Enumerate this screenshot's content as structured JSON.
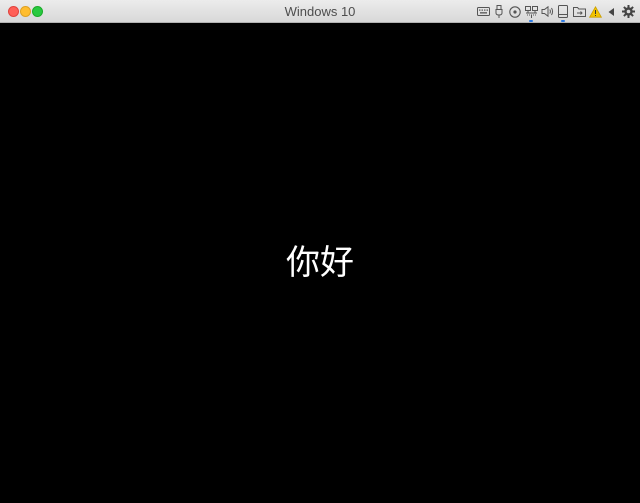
{
  "window": {
    "title": "Windows 10"
  },
  "vm_screen": {
    "greeting": "你好",
    "background_color": "#000000"
  },
  "status_icons": [
    {
      "name": "keyboard-icon",
      "active": false
    },
    {
      "name": "usb-icon",
      "active": false
    },
    {
      "name": "optical-disc-icon",
      "active": false
    },
    {
      "name": "network-icon",
      "active": true
    },
    {
      "name": "audio-icon",
      "active": false
    },
    {
      "name": "hard-disk-icon",
      "active": true
    },
    {
      "name": "shared-folder-icon",
      "active": false
    },
    {
      "name": "warning-icon",
      "active": false
    },
    {
      "name": "arrow-left-icon",
      "active": false
    },
    {
      "name": "settings-gear-icon",
      "active": false
    }
  ],
  "colors": {
    "accent_indicator": "#2d7be5",
    "warning": "#f2c300"
  }
}
